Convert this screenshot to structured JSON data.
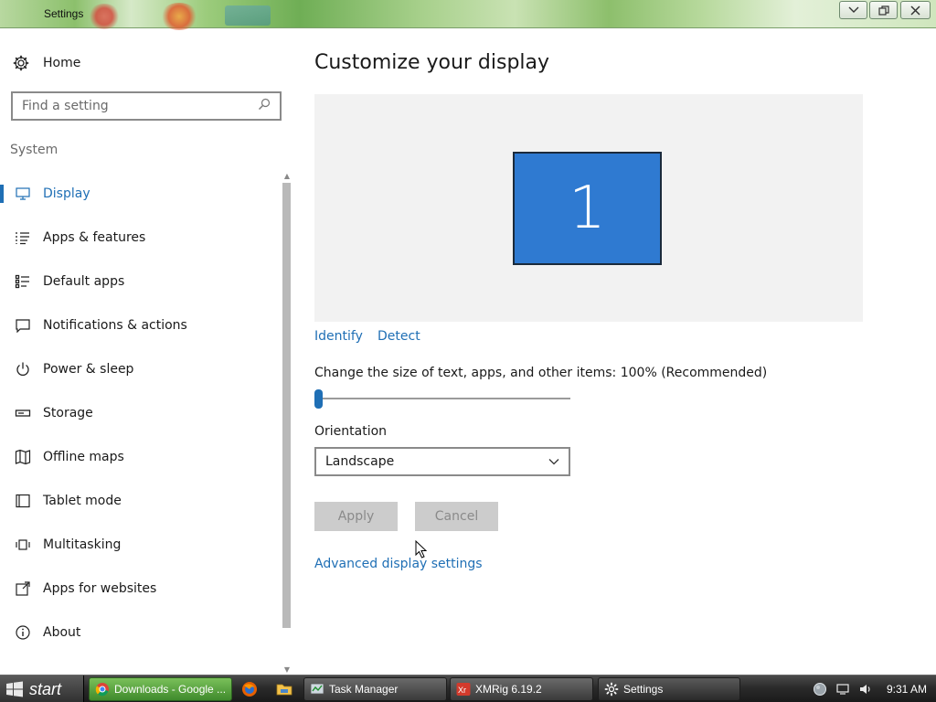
{
  "window": {
    "title": "Settings",
    "controls": [
      "chevron-down",
      "restore",
      "close"
    ]
  },
  "sidebar": {
    "home_label": "Home",
    "search_placeholder": "Find a setting",
    "section_label": "System",
    "items": [
      {
        "label": "Display",
        "icon": "monitor-icon",
        "active": true
      },
      {
        "label": "Apps & features",
        "icon": "list-icon"
      },
      {
        "label": "Default apps",
        "icon": "default-apps-icon"
      },
      {
        "label": "Notifications & actions",
        "icon": "notification-icon"
      },
      {
        "label": "Power & sleep",
        "icon": "power-icon"
      },
      {
        "label": "Storage",
        "icon": "storage-icon"
      },
      {
        "label": "Offline maps",
        "icon": "map-icon"
      },
      {
        "label": "Tablet mode",
        "icon": "tablet-icon"
      },
      {
        "label": "Multitasking",
        "icon": "multitasking-icon"
      },
      {
        "label": "Apps for websites",
        "icon": "apps-websites-icon"
      },
      {
        "label": "About",
        "icon": "info-icon"
      }
    ]
  },
  "main": {
    "title": "Customize your display",
    "monitor_number": "1",
    "identify_label": "Identify",
    "detect_label": "Detect",
    "scale_label": "Change the size of text, apps, and other items: 100% (Recommended)",
    "scale_value_fraction": 0,
    "orientation_label": "Orientation",
    "orientation_value": "Landscape",
    "apply_label": "Apply",
    "cancel_label": "Cancel",
    "advanced_link": "Advanced display settings"
  },
  "taskbar": {
    "start_label": "start",
    "tasks": [
      {
        "label": "Downloads - Google ...",
        "icon": "chrome-icon"
      },
      {
        "label": "Task Manager",
        "icon": "task-manager-icon"
      },
      {
        "label": "XMRig 6.19.2",
        "icon": "xmrig-icon"
      },
      {
        "label": "Settings",
        "icon": "gear-icon"
      }
    ],
    "clock": "9:31 AM"
  },
  "colors": {
    "accent": "#1f6fb5",
    "monitor_fill": "#2f7ad1",
    "preview_bg": "#f2f2f2"
  }
}
